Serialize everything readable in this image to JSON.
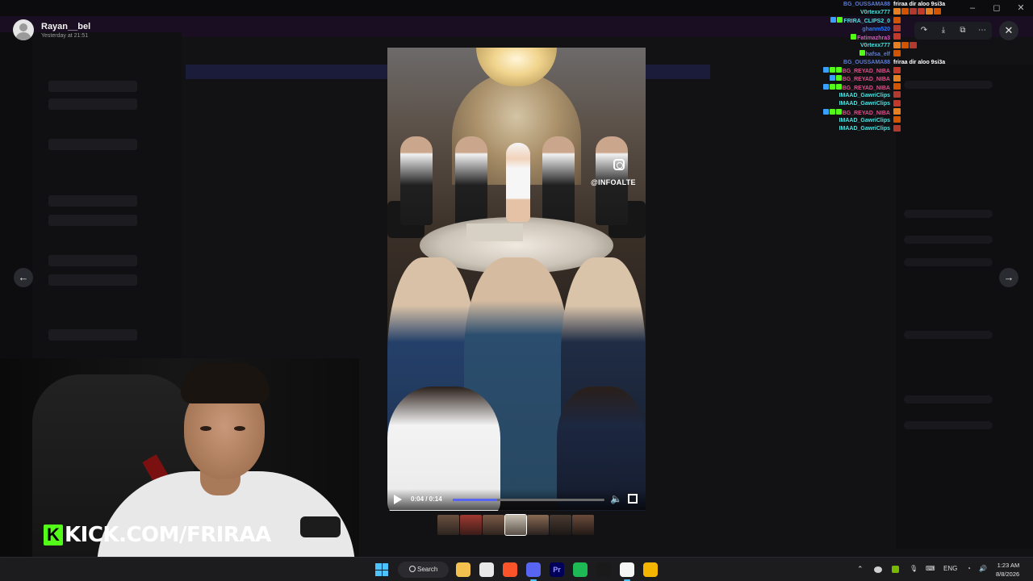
{
  "post": {
    "author": "Rayan__bel",
    "timestamp": "Yesterday at 21:51"
  },
  "toolbar": {
    "icons": [
      "forward-icon",
      "download-icon",
      "open-in-new-icon",
      "more-icon"
    ],
    "close": "✕"
  },
  "nav": {
    "prev": "←",
    "next": "→"
  },
  "video": {
    "watermark": "@INFOALTE",
    "time": "0:04 / 0:14",
    "progress": 0.29
  },
  "chat": [
    {
      "name": "BG_OUSSAMA88",
      "color": "#5b7bd5",
      "msg": "friraa dir aloo 9si3a",
      "badges": [],
      "emotes": 0
    },
    {
      "name": "V0rtexx777",
      "color": "#4fe0e0",
      "msg": "",
      "badges": [],
      "emotes": 6
    },
    {
      "name": "FRIRA_CLIPS2_0",
      "color": "#4fe0e0",
      "msg": "",
      "badges": [
        "#3aa0ff",
        "#53fc18"
      ],
      "emotes": 1
    },
    {
      "name": "ghanm520",
      "color": "#2a7cff",
      "msg": "",
      "badges": [],
      "emotes": 1
    },
    {
      "name": "Fatimazhra3",
      "color": "#e052c9",
      "msg": "",
      "badges": [
        "#53fc18"
      ],
      "emotes": 1
    },
    {
      "name": "V0rtexx777",
      "color": "#4fe0e0",
      "msg": "",
      "badges": [],
      "emotes": 3
    },
    {
      "name": "hafsa_elf",
      "color": "#5b7bd5",
      "msg": "",
      "badges": [
        "#53fc18"
      ],
      "emotes": 1
    },
    {
      "name": "BG_OUSSAMA88",
      "color": "#5b7bd5",
      "msg": "friraa dir aloo 9si3a",
      "badges": [],
      "emotes": 0
    },
    {
      "name": "BG_REYAD_NIBA",
      "color": "#e64b8c",
      "msg": "",
      "badges": [
        "#3aa0ff",
        "#53fc18",
        "#53fc18"
      ],
      "emotes": 1
    },
    {
      "name": "BG_REYAD_NIBA",
      "color": "#e64b8c",
      "msg": "",
      "badges": [
        "#3aa0ff",
        "#53fc18"
      ],
      "emotes": 1
    },
    {
      "name": "BG_REYAD_NIBA",
      "color": "#e64b8c",
      "msg": "",
      "badges": [
        "#3aa0ff",
        "#53fc18",
        "#53fc18"
      ],
      "emotes": 1
    },
    {
      "name": "IMAAD_GawriClips",
      "color": "#4fe0e0",
      "msg": "",
      "badges": [],
      "emotes": 1
    },
    {
      "name": "IMAAD_GawriClips",
      "color": "#4fe0e0",
      "msg": "",
      "badges": [],
      "emotes": 1
    },
    {
      "name": "BG_REYAD_NIBA",
      "color": "#e64b8c",
      "msg": "",
      "badges": [
        "#3aa0ff",
        "#53fc18",
        "#53fc18"
      ],
      "emotes": 1
    },
    {
      "name": "IMAAD_GawriClips",
      "color": "#4fe0e0",
      "msg": "",
      "badges": [],
      "emotes": 1
    },
    {
      "name": "IMAAD_GawriClips",
      "color": "#4fe0e0",
      "msg": "",
      "badges": [],
      "emotes": 1
    }
  ],
  "overlay": {
    "kick_k": "K",
    "kick_text": "KICK.COM/FRIRAA"
  },
  "taskbar": {
    "search_label": "Search",
    "lang": "ENG",
    "time": "1:23 AM",
    "date": "8/8/2026",
    "apps": [
      {
        "name": "file-explorer-icon",
        "color": "#f2c14e",
        "glyph": ""
      },
      {
        "name": "snipping-tool-icon",
        "color": "#e8e8e8",
        "glyph": ""
      },
      {
        "name": "brave-icon",
        "color": "#fb542b",
        "glyph": ""
      },
      {
        "name": "discord-icon",
        "color": "#5865f2",
        "glyph": ""
      },
      {
        "name": "premiere-pro-icon",
        "color": "#00005b",
        "glyph": "Pr"
      },
      {
        "name": "spotify-icon",
        "color": "#1db954",
        "glyph": ""
      },
      {
        "name": "nvidia-icon",
        "color": "#1a1a1a",
        "glyph": ""
      },
      {
        "name": "document-icon",
        "color": "#f5f5f5",
        "glyph": ""
      },
      {
        "name": "chrome-icon",
        "color": "#f4b400",
        "glyph": ""
      }
    ]
  }
}
